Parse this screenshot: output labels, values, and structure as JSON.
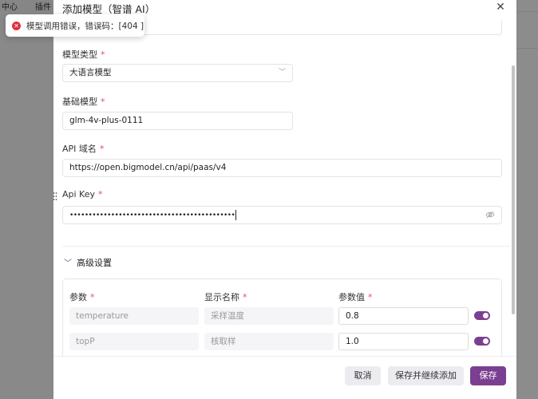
{
  "background": {
    "nav_items": [
      "中心",
      "插件"
    ]
  },
  "toast": {
    "icon": "error-icon",
    "message": "模型调用错误，错误码：[404 ]"
  },
  "drawer": {
    "title": "添加模型（智谱 AI）",
    "close_icon": "close-icon",
    "fields": {
      "model_type": {
        "label": "模型类型",
        "required": "*",
        "value": "大语言模型",
        "chevron": "chevron-down-icon"
      },
      "base_model": {
        "label": "基础模型",
        "required": "*",
        "value": "glm-4v-plus-0111"
      },
      "api_domain": {
        "label": "API 域名",
        "required": "*",
        "value": "https://open.bigmodel.cn/api/paas/v4"
      },
      "api_key": {
        "label": "Api Key",
        "required": "*",
        "value": "••••••••••••••••••••••••••••••••••••••••••••",
        "eye_icon": "eye-off-icon"
      }
    },
    "advanced": {
      "label": "高级设置",
      "expanded": true,
      "columns": [
        {
          "label": "参数",
          "required": "*"
        },
        {
          "label": "显示名称",
          "required": "*"
        },
        {
          "label": "参数值",
          "required": "*"
        }
      ],
      "rows": [
        {
          "param": "temperature",
          "display_name": "采样温度",
          "value": "0.8",
          "enabled": true
        },
        {
          "param": "topP",
          "display_name": "核取样",
          "value": "1.0",
          "enabled": true
        }
      ]
    },
    "footer": {
      "cancel": "取消",
      "save_and_continue": "保存并继续添加",
      "save": "保存"
    }
  },
  "colors": {
    "accent": "#7b3f92",
    "error": "#e0303c",
    "required": "#e34d59"
  }
}
